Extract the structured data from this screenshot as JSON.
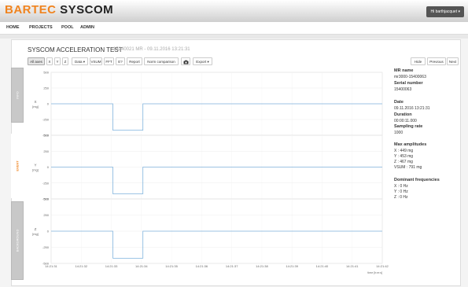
{
  "app": {
    "logo_a": "BARTEC",
    "logo_b": "SYSCOM",
    "user": "Hi barthjacquet ▾"
  },
  "nav": {
    "items": [
      "HOME",
      "PROJECTS",
      "POOL",
      "ADMIN"
    ]
  },
  "sidetabs": [
    "INFO",
    "EVENT",
    "BACKGROUND"
  ],
  "title": "SYSCOM ACCELERATION TEST",
  "subtitle": "15240021 MR - 09.11.2016 13:21:31",
  "toolbar": {
    "axes": [
      "All axes",
      "X",
      "Y",
      "Z"
    ],
    "data": "Data ▾",
    "vsum": "VSUM",
    "fft": "FFT",
    "e": "E?",
    "report": "Report",
    "norm": "Norm comparison",
    "camera_icon": "camera-icon",
    "export": "Export ▾",
    "hide": "Hide",
    "previous": "Previous",
    "next": "Next"
  },
  "info": {
    "mr_name_label": "MR name",
    "mr_name": "mr3000-15400063",
    "serial_label": "Serial number",
    "serial": "15400063",
    "date_label": "Date",
    "date": "09.11.2016 13:21:31",
    "duration_label": "Duration",
    "duration": "00:00:11.000",
    "sampling_label": "Sampling rate",
    "sampling": "1000",
    "max_label": "Max amplitudes",
    "max_x": "X : 449 mg",
    "max_y": "Y : 453 mg",
    "max_z": "Z : 467 mg",
    "max_vsum": "VSUM : 791 mg",
    "dom_label": "Dominant frequencies",
    "dom_x": "X : 0 Hz",
    "dom_y": "Y : 0 Hz",
    "dom_z": "Z : 0 Hz"
  },
  "chart_data": {
    "type": "line",
    "xlabel": "time [h:m:s]",
    "x_ticks": [
      "14:21:31",
      "14:21:32",
      "14:21:33",
      "14:21:34",
      "14:21:35",
      "14:21:36",
      "14:21:37",
      "14:21:38",
      "14:21:39",
      "14:21:40",
      "14:21:41",
      "14:21:42"
    ],
    "y_ticks": [
      500,
      250,
      0,
      -250,
      -500
    ],
    "ylim": [
      -500,
      500
    ],
    "unit": "[mg]",
    "color": "#7fb3dd",
    "series": [
      {
        "name": "X",
        "points": [
          [
            0,
            0
          ],
          [
            2.05,
            0
          ],
          [
            2.05,
            -420
          ],
          [
            3.05,
            -420
          ],
          [
            3.05,
            0
          ],
          [
            11,
            0
          ]
        ]
      },
      {
        "name": "Y",
        "points": [
          [
            0,
            0
          ],
          [
            2.05,
            0
          ],
          [
            2.05,
            -420
          ],
          [
            3.05,
            -420
          ],
          [
            3.05,
            0
          ],
          [
            11,
            0
          ]
        ]
      },
      {
        "name": "Z",
        "points": [
          [
            0,
            0
          ],
          [
            2.05,
            0
          ],
          [
            2.05,
            -420
          ],
          [
            3.05,
            -420
          ],
          [
            3.05,
            0
          ],
          [
            11,
            0
          ]
        ]
      }
    ]
  }
}
